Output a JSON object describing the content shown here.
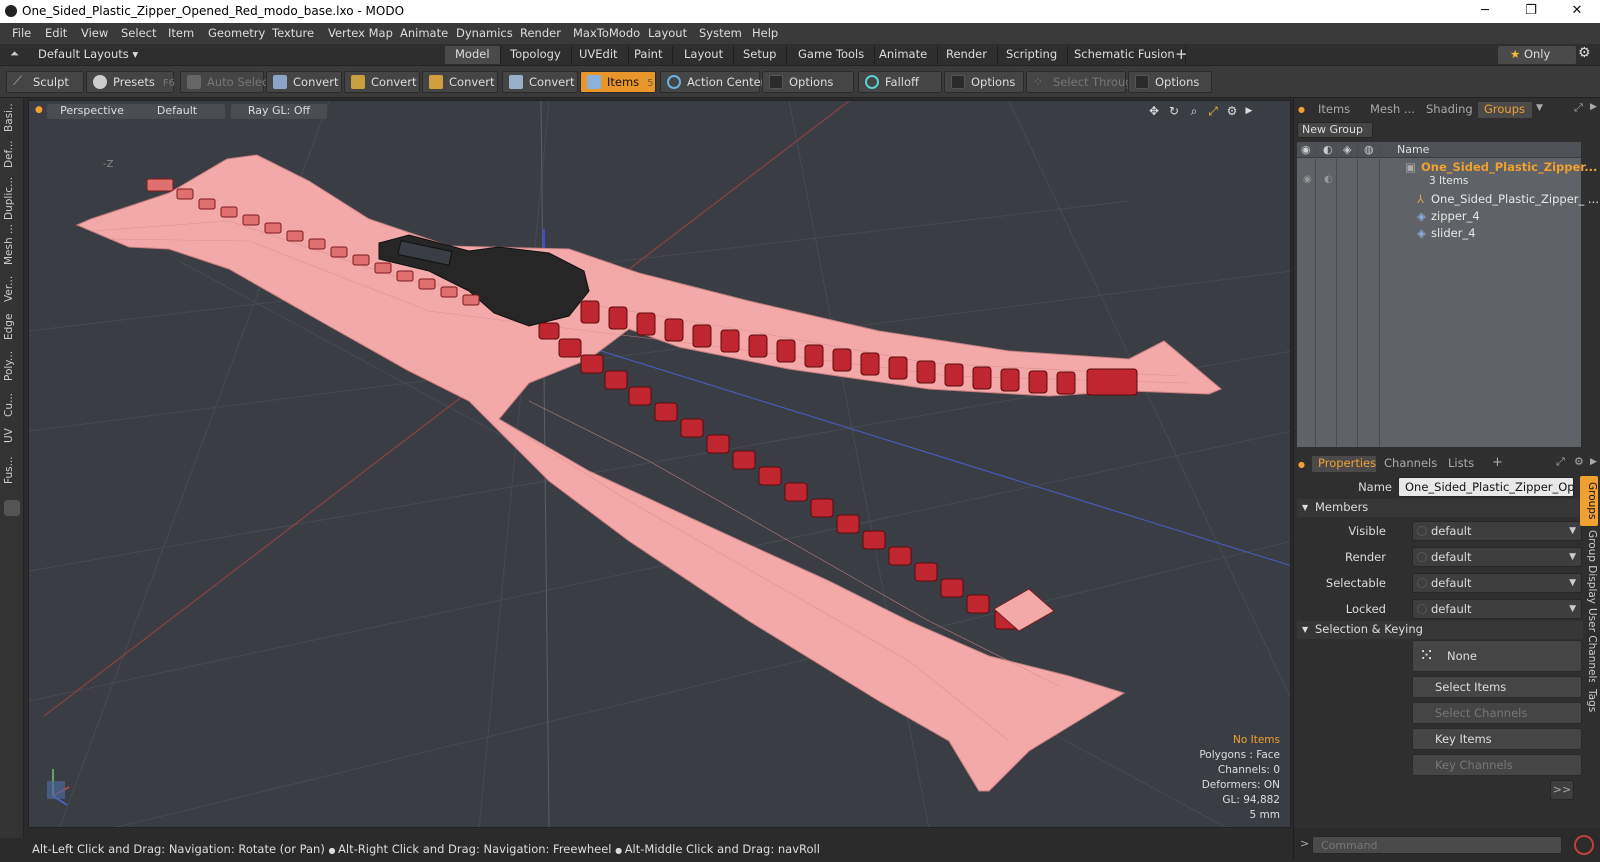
{
  "window": {
    "title": "One_Sided_Plastic_Zipper_Opened_Red_modo_base.lxo - MODO",
    "minimize": "─",
    "maximize": "❐",
    "close": "✕"
  },
  "menu": [
    "File",
    "Edit",
    "View",
    "Select",
    "Item",
    "Geometry",
    "Texture",
    "Vertex Map",
    "Animate",
    "Dynamics",
    "Render",
    "MaxToModo",
    "Layout",
    "System",
    "Help"
  ],
  "layoutbar": {
    "default_layouts": "Default Layouts ▾",
    "tabs": [
      "Model",
      "Topology",
      "UVEdit",
      "Paint",
      "Layout",
      "Setup",
      "Game Tools",
      "Animate",
      "Render",
      "Scripting",
      "Schematic Fusion"
    ],
    "active_tab": "Model",
    "add_tab": "+",
    "only": "Only",
    "star": "★"
  },
  "toolbar": {
    "sculpt": "Sculpt",
    "presets": "Presets",
    "presets_key": "F6",
    "auto_select": "Auto Select",
    "convert": "Convert",
    "items": "Items",
    "items_key": "5",
    "action_center": "Action Center",
    "options": "Options",
    "falloff": "Falloff",
    "select_through": "Select Through"
  },
  "left_tabs": [
    "Basi...",
    "Def...",
    "Duplic...",
    "Mesh ...",
    "Ver...",
    "Edge",
    "Poly...",
    "Cu...",
    "UV",
    "Fus..."
  ],
  "viewport": {
    "view": "Perspective",
    "shading": "Default",
    "raygl": "Ray GL: Off",
    "axis_hint": "-Z",
    "info": {
      "no_items": "No Items",
      "polygons": "Polygons : Face",
      "channels": "Channels: 0",
      "deformers": "Deformers: ON",
      "gl": "GL: 94,882",
      "scale": "5 mm"
    },
    "colors": {
      "bg": "#3a3e44",
      "mesh": "#f2a2a2",
      "teeth": "#c0202a",
      "slider": "#222222"
    }
  },
  "statusbar": {
    "hint1": "Alt-Left Click and Drag: Navigation: Rotate (or Pan)",
    "hint2": "Alt-Right Click and Drag: Navigation: Freewheel",
    "hint3": "Alt-Middle Click and Drag: navRoll"
  },
  "groups_panel": {
    "tabs": [
      "Items",
      "Mesh ...",
      "Shading",
      "Groups"
    ],
    "active_tab": "Groups",
    "new_group": "New Group",
    "name_col": "Name",
    "group_name": "One_Sided_Plastic_Zipper...",
    "group_count": "3 Items",
    "children": [
      "One_Sided_Plastic_Zipper_ ...",
      "zipper_4",
      "slider_4"
    ]
  },
  "properties": {
    "tabs": [
      "Properties",
      "Channels",
      "Lists"
    ],
    "add": "+",
    "name_label": "Name",
    "name_value": "One_Sided_Plastic_Zipper_Opene",
    "members": "Members",
    "visible_label": "Visible",
    "visible": "default",
    "render_label": "Render",
    "render": "default",
    "selectable_label": "Selectable",
    "selectable": "default",
    "locked_label": "Locked",
    "locked": "default",
    "selection_keying": "Selection & Keying",
    "none": "None",
    "select_items": "Select Items",
    "select_channels": "Select Channels",
    "key_items": "Key Items",
    "key_channels": "Key Channels",
    "more": ">>",
    "side_tabs": [
      "Groups",
      "Group Display",
      "User Channels",
      "Tags"
    ]
  },
  "command": {
    "placeholder": "Command",
    "prompt": ">"
  }
}
